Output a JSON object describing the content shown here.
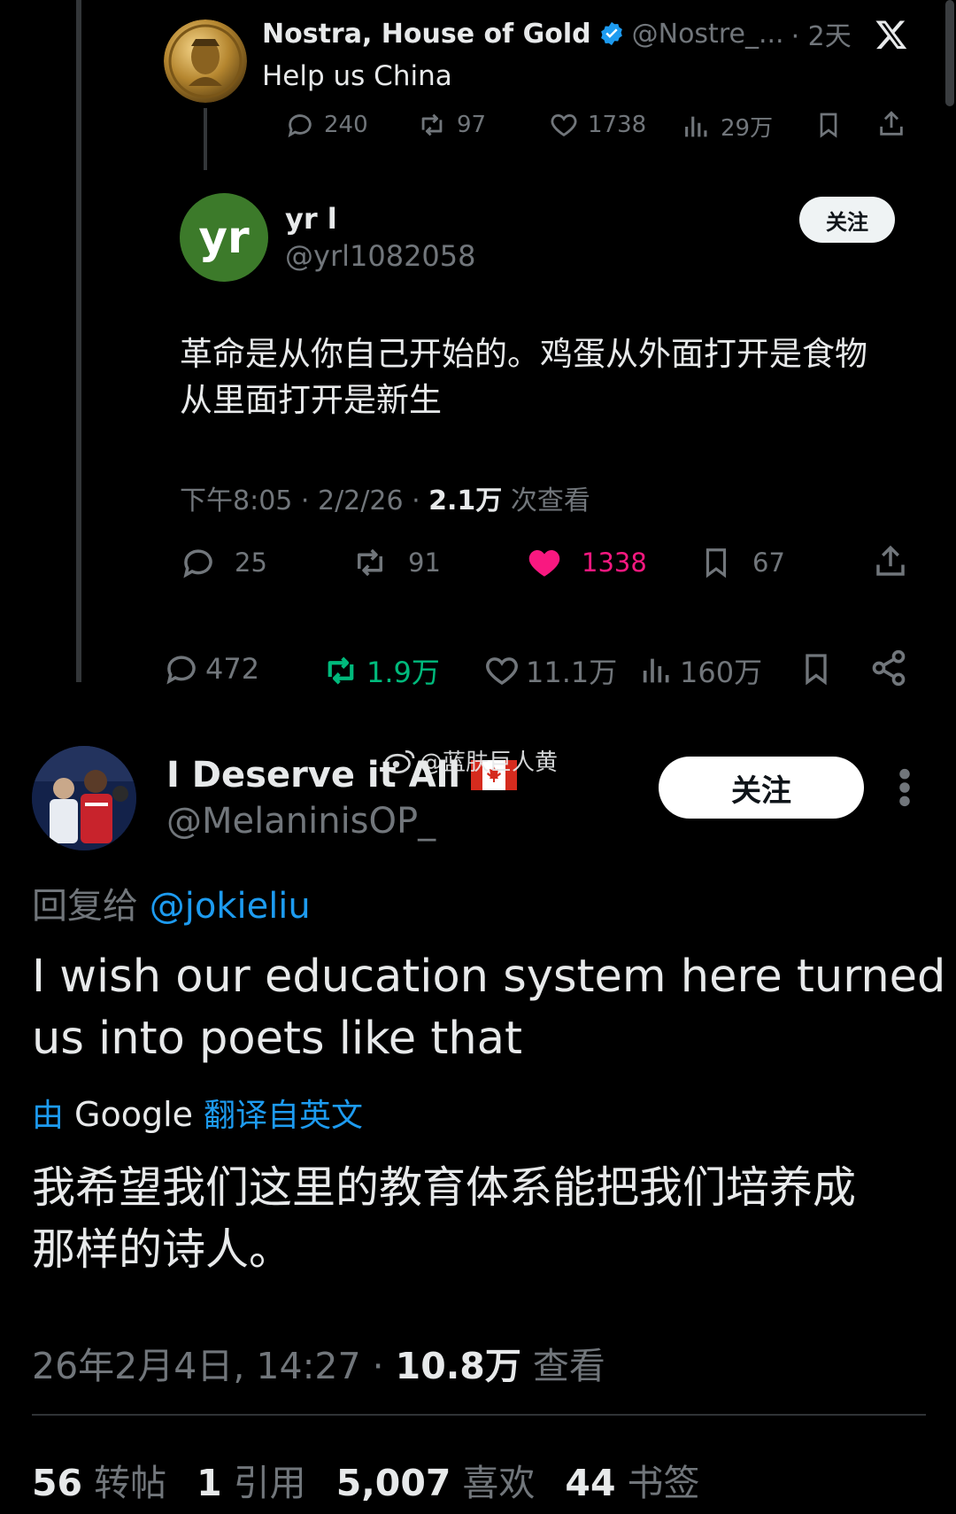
{
  "quoted_tweet": {
    "name": "Nostra, House of Gold",
    "handle": "@Nostre_...",
    "time": "· 2天",
    "text": "Help us China",
    "stats": {
      "replies": "240",
      "retweets": "97",
      "likes": "1738",
      "views": "29万"
    }
  },
  "reply_tweet": {
    "avatar_text": "yr",
    "name": "yr l",
    "handle": "@yrl1082058",
    "follow_label": "关注",
    "text_line1": "革命是从你自己开始的。鸡蛋从外面打开是食物",
    "text_line2": "从里面打开是新生",
    "meta_time": "下午8:05 · 2/2/26 · ",
    "meta_views": "2.1万",
    "meta_suffix": " 次查看",
    "stats": {
      "replies": "25",
      "retweets": "91",
      "likes": "1338",
      "bookmarks": "67"
    }
  },
  "outer_actions": {
    "replies": "472",
    "retweets": "1.9万",
    "likes": "11.1万",
    "views": "160万"
  },
  "watermark": "@蓝肤巨人黄",
  "main_tweet": {
    "name": "I Deserve it All",
    "handle": "@MelaninisOP_",
    "follow_label": "关注",
    "reply_prefix": "回复给",
    "reply_to": "@jokieliu",
    "text_line1": "I wish our education system here turned",
    "text_line2": "us into poets like that",
    "translate_prefix": "由",
    "translate_brand": "Google",
    "translate_suffix": "翻译自英文",
    "translation_line1": "我希望我们这里的教育体系能把我们培养成",
    "translation_line2": "那样的诗人。",
    "meta_time": "26年2月4日, 14:27 · ",
    "meta_views": "10.8万",
    "meta_suffix": " 查看",
    "counts": {
      "retweets_num": "56",
      "retweets_label": "转帖",
      "quotes_num": "1",
      "quotes_label": "引用",
      "likes_num": "5,007",
      "likes_label": "喜欢",
      "bookmarks_num": "44",
      "bookmarks_label": "书签"
    }
  },
  "colors": {
    "background": "#000000",
    "text": "#e7e9ea",
    "muted": "#71767b",
    "link": "#1d9bf0",
    "like_pink": "#f91880",
    "retweet_green": "#00ba7c",
    "verified": "#1d9bf0"
  }
}
